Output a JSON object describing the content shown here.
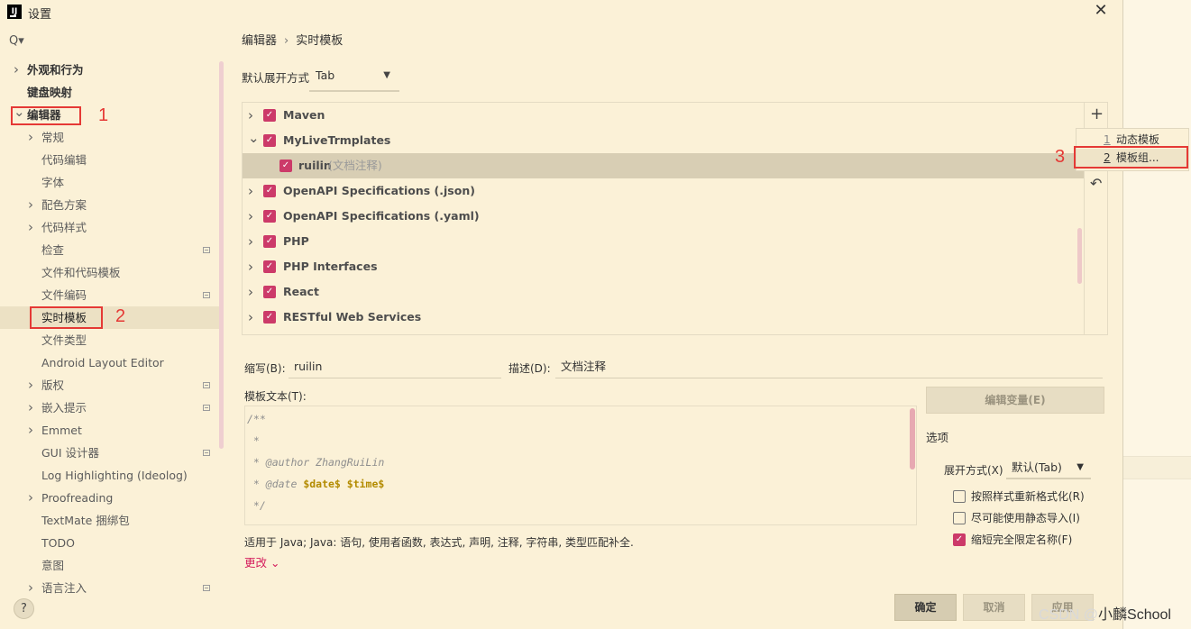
{
  "window": {
    "title": "设置",
    "close": "✕"
  },
  "sidebar": {
    "search_icon": "Q▾",
    "items": [
      {
        "label": "外观和行为",
        "level": 0,
        "expand": "collapsed"
      },
      {
        "label": "键盘映射",
        "level": 0,
        "expand": "none"
      },
      {
        "label": "编辑器",
        "level": 0,
        "expand": "expanded"
      },
      {
        "label": "常规",
        "level": 1,
        "expand": "collapsed"
      },
      {
        "label": "代码编辑",
        "level": 1,
        "expand": "none"
      },
      {
        "label": "字体",
        "level": 1,
        "expand": "none"
      },
      {
        "label": "配色方案",
        "level": 1,
        "expand": "collapsed"
      },
      {
        "label": "代码样式",
        "level": 1,
        "expand": "collapsed"
      },
      {
        "label": "检查",
        "level": 1,
        "expand": "none",
        "icon": true
      },
      {
        "label": "文件和代码模板",
        "level": 1,
        "expand": "none"
      },
      {
        "label": "文件编码",
        "level": 1,
        "expand": "none",
        "icon": true
      },
      {
        "label": "实时模板",
        "level": 1,
        "expand": "none",
        "selected": true
      },
      {
        "label": "文件类型",
        "level": 1,
        "expand": "none"
      },
      {
        "label": "Android Layout Editor",
        "level": 1,
        "expand": "none"
      },
      {
        "label": "版权",
        "level": 1,
        "expand": "collapsed",
        "icon": true
      },
      {
        "label": "嵌入提示",
        "level": 1,
        "expand": "collapsed",
        "icon": true
      },
      {
        "label": "Emmet",
        "level": 1,
        "expand": "collapsed"
      },
      {
        "label": "GUI 设计器",
        "level": 1,
        "expand": "none",
        "icon": true
      },
      {
        "label": "Log Highlighting (Ideolog)",
        "level": 1,
        "expand": "none"
      },
      {
        "label": "Proofreading",
        "level": 1,
        "expand": "collapsed"
      },
      {
        "label": "TextMate 捆绑包",
        "level": 1,
        "expand": "none"
      },
      {
        "label": "TODO",
        "level": 1,
        "expand": "none"
      },
      {
        "label": "意图",
        "level": 1,
        "expand": "none"
      },
      {
        "label": "语言注入",
        "level": 1,
        "expand": "collapsed",
        "icon": true
      }
    ],
    "help": "?"
  },
  "annotations": {
    "n1": "1",
    "n2": "2",
    "n3": "3"
  },
  "breadcrumb": {
    "part1": "编辑器",
    "sep": "›",
    "part2": "实时模板"
  },
  "expand_setting": {
    "label": "默认展开方式",
    "value": "Tab"
  },
  "template_tree": {
    "rows": [
      {
        "label": "Maven",
        "expand": "collapsed",
        "checked": true
      },
      {
        "label": "MyLiveTrmplates",
        "expand": "expanded",
        "checked": true
      },
      {
        "label": "ruilin",
        "desc": "(文档注释)",
        "child": true,
        "checked": true,
        "selected": true
      },
      {
        "label": "OpenAPI Specifications (.json)",
        "expand": "collapsed",
        "checked": true
      },
      {
        "label": "OpenAPI Specifications (.yaml)",
        "expand": "collapsed",
        "checked": true
      },
      {
        "label": "PHP",
        "expand": "collapsed",
        "checked": true
      },
      {
        "label": "PHP Interfaces",
        "expand": "collapsed",
        "checked": true
      },
      {
        "label": "React",
        "expand": "collapsed",
        "checked": true
      },
      {
        "label": "RESTful Web Services",
        "expand": "collapsed",
        "checked": true
      }
    ]
  },
  "toolbar": {
    "add": "+",
    "undo": "↶"
  },
  "add_menu": {
    "items": [
      {
        "key": "1",
        "label": "动态模板"
      },
      {
        "key": "2",
        "label": "模板组..."
      }
    ]
  },
  "editor": {
    "abbr_label": "缩写(B):",
    "abbr_value": "ruilin",
    "desc_label": "描述(D):",
    "desc_value": "文档注释",
    "template_text_label": "模板文本(T):",
    "code_lines": [
      {
        "text": "/**"
      },
      {
        "text": " *"
      },
      {
        "text": " * @author ZhangRuiLin"
      },
      {
        "text": " * @date ",
        "vars": "$date$ $time$"
      },
      {
        "text": " */"
      }
    ],
    "edit_vars_button": "编辑变量(E)",
    "applies_to": "适用于 Java; Java: 语句, 使用者函数, 表达式, 声明, 注释, 字符串, 类型匹配补全.",
    "change_link": "更改 ⌄"
  },
  "options": {
    "title": "选项",
    "expand_label": "展开方式(X)",
    "expand_value": "默认(Tab)",
    "checkboxes": [
      {
        "label": "按照样式重新格式化(R)",
        "checked": false
      },
      {
        "label": "尽可能使用静态导入(I)",
        "checked": false
      },
      {
        "label": "缩短完全限定名称(F)",
        "checked": true
      }
    ]
  },
  "footer": {
    "ok": "确定",
    "cancel": "取消",
    "apply": "应用"
  },
  "watermark": {
    "prefix": "CSDN @",
    "name": "小麟School"
  }
}
